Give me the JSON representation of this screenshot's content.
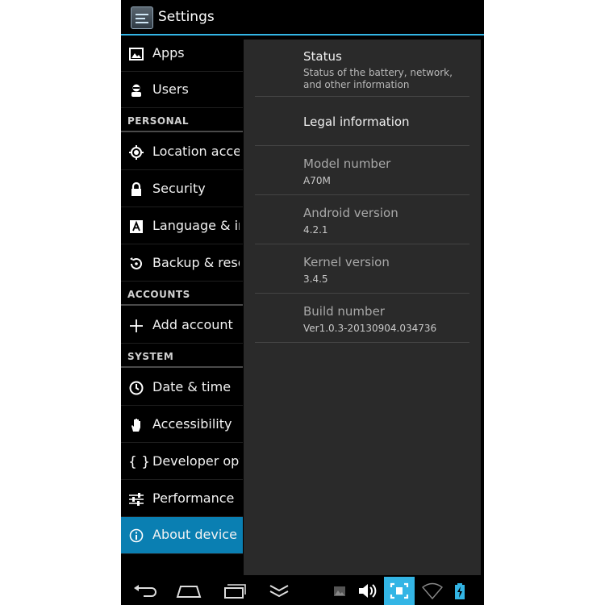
{
  "app_title": "Settings",
  "nav": {
    "items_top": [
      {
        "label": "Apps",
        "icon": "apps-icon"
      },
      {
        "label": "Users",
        "icon": "users-icon"
      }
    ],
    "headers": {
      "personal": "PERSONAL",
      "accounts": "ACCOUNTS",
      "system": "SYSTEM"
    },
    "personal": [
      {
        "label": "Location access",
        "icon": "location-icon"
      },
      {
        "label": "Security",
        "icon": "lock-icon"
      },
      {
        "label": "Language & input",
        "icon": "language-icon"
      },
      {
        "label": "Backup & reset",
        "icon": "backup-icon"
      }
    ],
    "accounts": [
      {
        "label": "Add account",
        "icon": "plus-icon"
      }
    ],
    "system": [
      {
        "label": "Date & time",
        "icon": "clock-icon"
      },
      {
        "label": "Accessibility",
        "icon": "hand-icon"
      },
      {
        "label": "Developer options",
        "icon": "braces-icon"
      },
      {
        "label": "Performance",
        "icon": "sliders-icon"
      },
      {
        "label": "About device",
        "icon": "info-icon"
      }
    ]
  },
  "detail": {
    "status": {
      "title": "Status",
      "summary": "Status of the battery, network, and other information"
    },
    "legal": {
      "title": "Legal information"
    },
    "model": {
      "title": "Model number",
      "value": "A70M"
    },
    "android": {
      "title": "Android version",
      "value": "4.2.1"
    },
    "kernel": {
      "title": "Kernel version",
      "value": "3.4.5"
    },
    "build": {
      "title": "Build number",
      "value": "Ver1.0.3-20130904.034736"
    }
  },
  "colors": {
    "accent": "#33b5e5",
    "selected": "#0a7fb2",
    "pane": "#2a2a2a"
  }
}
